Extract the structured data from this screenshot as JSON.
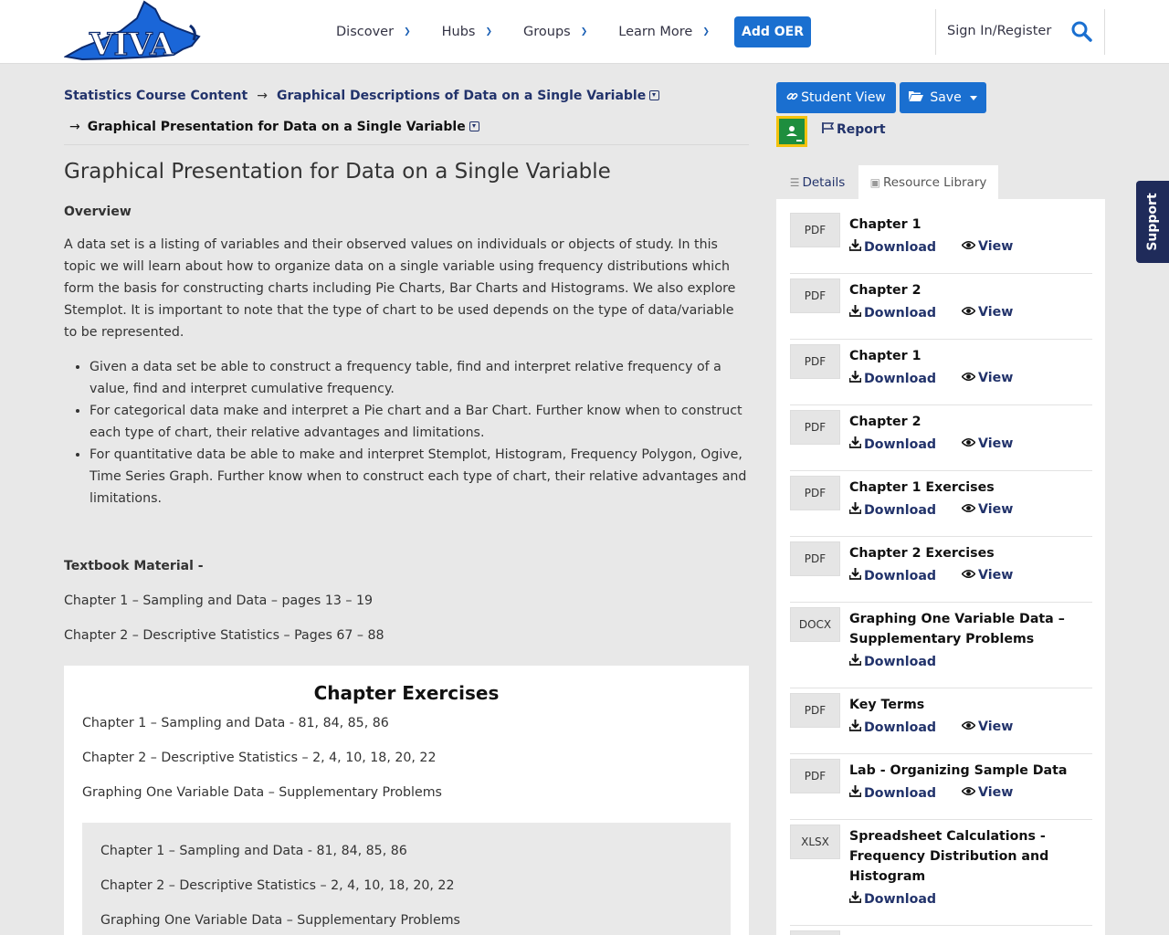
{
  "header": {
    "logo_text": "VIVA",
    "nav": [
      "Discover",
      "Hubs",
      "Groups",
      "Learn More"
    ],
    "add_oer": "Add OER",
    "signin": "Sign In/Register"
  },
  "breadcrumb": {
    "item1": "Statistics Course Content",
    "item2": "Graphical Descriptions of Data on a Single Variable",
    "item3": "Graphical Presentation for Data on a Single Variable",
    "arrow": "→"
  },
  "main": {
    "title": "Graphical Presentation for Data on a Single Variable",
    "overview_heading": "Overview",
    "intro": "A data set is a listing of variables and their observed values on individuals or objects of study. In this topic we will learn about how to organize data on a single variable using frequency distributions which form the basis for constructing charts including Pie Charts, Bar Charts and Histograms. We also explore Stemplot. It is important to note that the type of chart to be used depends on the type of data/variable to be represented.",
    "goals": [
      "Given a data set be able to construct a frequency table, find and interpret relative frequency of a value, find and interpret cumulative frequency.",
      "For categorical data make and interpret a Pie chart and a Bar Chart. Further know when to construct each type of chart, their relative advantages and limitations.",
      "For quantitative data be able to make and interpret Stemplot, Histogram, Frequency Polygon, Ogive, Time Series Graph. Further know when to construct each type of chart, their relative advantages and limitations."
    ],
    "textbook_heading": "Textbook Material -",
    "textbook": [
      "Chapter 1 – Sampling and Data – pages 13 – 19",
      "Chapter 2 – Descriptive Statistics – Pages 67 – 88"
    ],
    "exercises_heading": "Chapter Exercises",
    "exercises": [
      "Chapter 1 – Sampling and Data - 81, 84, 85, 86",
      "Chapter 2 – Descriptive Statistics – 2, 4, 10, 18, 20, 22",
      "Graphing One Variable Data – Supplementary Problems"
    ]
  },
  "sidebar": {
    "student_view": "Student View",
    "save": "Save",
    "report": "Report",
    "tab_details": "Details",
    "tab_library": "Resource Library",
    "download": "Download",
    "view": "View",
    "resources": [
      {
        "type": "PDF",
        "title": "Chapter 1",
        "view": true
      },
      {
        "type": "PDF",
        "title": "Chapter 2",
        "view": true
      },
      {
        "type": "PDF",
        "title": "Chapter 1",
        "view": true
      },
      {
        "type": "PDF",
        "title": "Chapter 2",
        "view": true
      },
      {
        "type": "PDF",
        "title": "Chapter 1 Exercises",
        "view": true
      },
      {
        "type": "PDF",
        "title": "Chapter 2 Exercises",
        "view": true
      },
      {
        "type": "DOCX",
        "title": "Graphing One Variable Data – Supplementary Problems",
        "view": false
      },
      {
        "type": "PDF",
        "title": "Key Terms",
        "view": true
      },
      {
        "type": "PDF",
        "title": "Lab - Organizing Sample Data",
        "view": true
      },
      {
        "type": "XLSX",
        "title": "Spreadsheet Calculations - Frequency Distribution and Histogram",
        "view": false
      }
    ]
  },
  "support": "Support",
  "colors": {
    "primary": "#1a6fd0",
    "navy": "#22336b",
    "support_bg": "#1f2b5a"
  }
}
